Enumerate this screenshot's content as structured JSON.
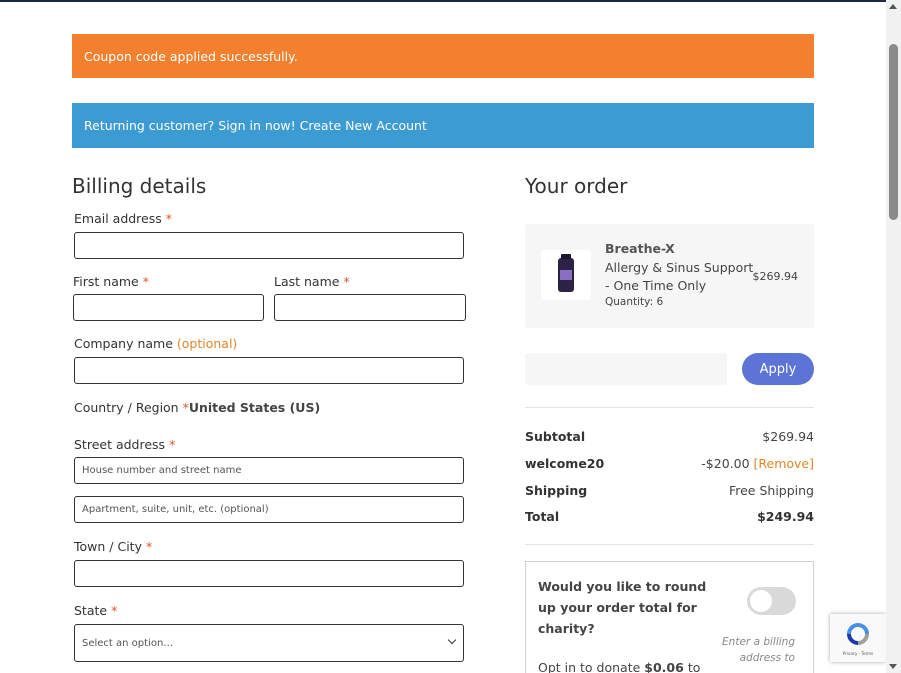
{
  "notices": {
    "success": "Coupon code applied successfully.",
    "info": "Returning customer? Sign in now! Create New Account"
  },
  "billing": {
    "title": "Billing details",
    "email_label": "Email address",
    "first_name_label": "First name",
    "last_name_label": "Last name",
    "company_label": "Company name",
    "company_optional": "(optional)",
    "country_label": "Country / Region",
    "country_value": "United States (US)",
    "street_label": "Street address",
    "street_placeholder": "House number and street name",
    "apt_placeholder": "Apartment, suite, unit, etc. (optional)",
    "city_label": "Town / City",
    "state_label": "State",
    "state_placeholder": "Select an option…",
    "required_mark": "*"
  },
  "order": {
    "title": "Your order",
    "product": {
      "brand": "Breathe-X",
      "name_line1": "Allergy & Sinus Support",
      "name_line2": "- One Time Only",
      "quantity": "Quantity: 6",
      "price": "$269.94"
    },
    "coupon_apply": "Apply",
    "totals": {
      "subtotal_label": "Subtotal",
      "subtotal_value": "$269.94",
      "coupon_label": "welcome20",
      "coupon_value": "-$20.00",
      "coupon_remove": "[Remove]",
      "shipping_label": "Shipping",
      "shipping_value": "Free Shipping",
      "total_label": "Total",
      "total_value": "$249.94"
    },
    "charity": {
      "question": "Would you like to round up your order total for charity?",
      "note": "Enter a billing address to",
      "optin": "Opt in to donate",
      "amount": "$0.06",
      "optin_suffix": "to"
    }
  },
  "recaptcha": {
    "text": "Privacy - Terms"
  },
  "colors": {
    "success_bg": "#f2802e",
    "info_bg": "#3d9bd4",
    "apply_btn": "#5b74d6",
    "required": "#e2502b",
    "optional": "#e0862a"
  }
}
